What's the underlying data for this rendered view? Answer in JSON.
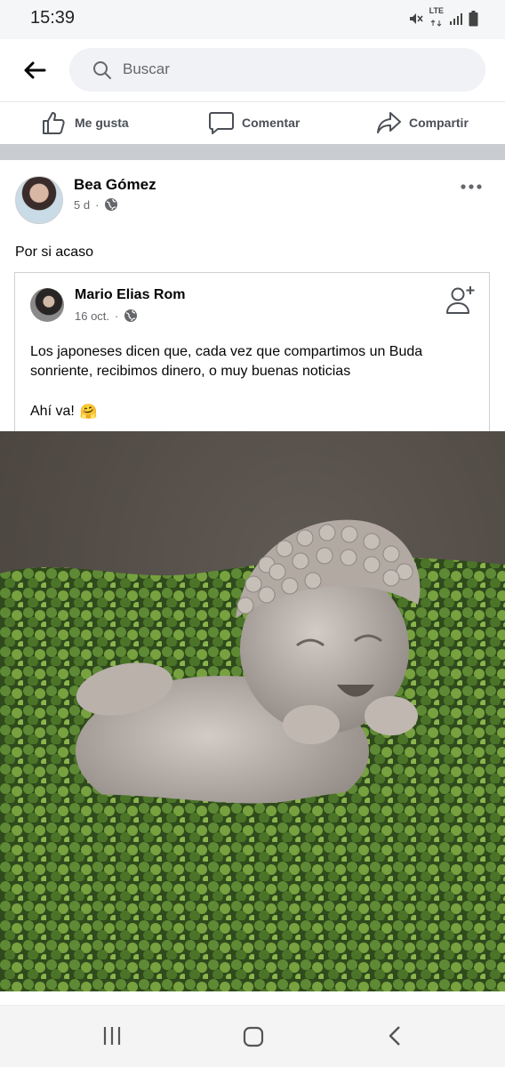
{
  "status_bar": {
    "time": "15:39",
    "network_label": "LTE",
    "icons": [
      "mute-icon",
      "lte-icon",
      "signal-icon",
      "battery-icon"
    ]
  },
  "search": {
    "placeholder": "Buscar",
    "icons": [
      "back-arrow-icon",
      "search-icon"
    ]
  },
  "actions": {
    "like_label": "Me gusta",
    "comment_label": "Comentar",
    "share_label": "Compartir",
    "icons": [
      "thumbs-up-icon",
      "comment-icon",
      "share-icon"
    ]
  },
  "post": {
    "author": "Bea Gómez",
    "time": "5 d",
    "privacy_icon": "globe-icon",
    "text": "Por si acaso",
    "more_icon": "more-options-icon",
    "shared": {
      "author": "Mario Elias Rom",
      "date": "16 oct.",
      "privacy_icon": "globe-icon",
      "add_friend_icon": "add-friend-icon",
      "text": "Los japoneses dicen que, cada vez que compartimos un Buda sonriente, recibimos dinero, o muy buenas noticias",
      "text2": "Ahí va!",
      "emoji": "🤗"
    },
    "image_subject": "smiling-buddha-statue"
  },
  "nav": {
    "icons": [
      "recent-apps-icon",
      "home-icon",
      "back-icon"
    ]
  },
  "colors": {
    "status_bg": "#f5f6f7",
    "search_bg": "#f0f2f5",
    "separator": "#c9ccd1",
    "text_primary": "#050505",
    "text_secondary": "#65676b"
  }
}
